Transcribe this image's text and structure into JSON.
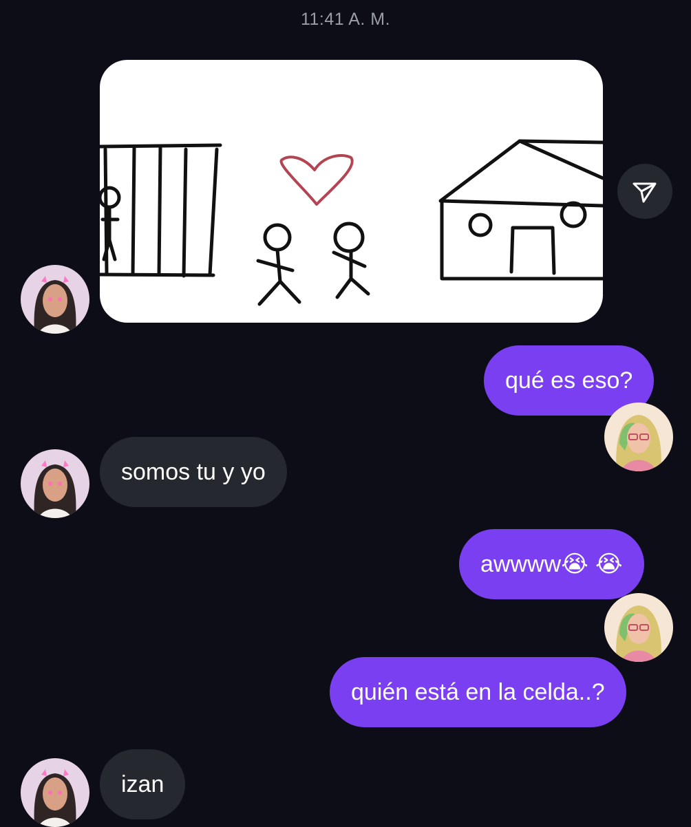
{
  "timestamp": "11:41 A. M.",
  "image_message": {
    "icon": "drawing-jail-couple-house",
    "share_icon": "paper-plane-icon"
  },
  "messages": [
    {
      "side": "out",
      "text": "qué es eso?"
    },
    {
      "side": "in",
      "text": "somos tu y yo"
    },
    {
      "side": "out",
      "text": "awwww",
      "emojis": [
        "😭",
        "😭"
      ]
    },
    {
      "side": "out",
      "text": "quién está en la celda..?"
    },
    {
      "side": "in",
      "text": "izan"
    }
  ],
  "colors": {
    "background": "#0c0d16",
    "incoming_bubble": "#262830",
    "outgoing_bubble": "#7b3ff2",
    "timestamp": "#9b9ea6"
  }
}
